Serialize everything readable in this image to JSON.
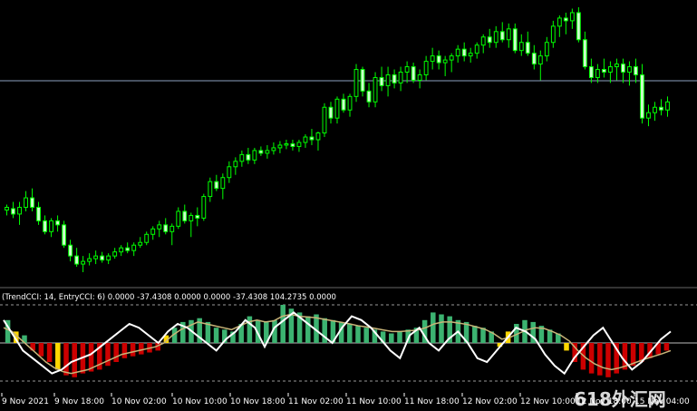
{
  "chart_data": [
    {
      "type": "candlestick",
      "title": "",
      "grid": false,
      "colors": {
        "up": "#00ff00",
        "up_body": "#000000",
        "down": "#00ff00",
        "down_body": "#ccffcc",
        "background": "#000000",
        "level_line": "#8b9fbf"
      },
      "y_range": [
        0,
        100
      ],
      "level": 74,
      "candles": [
        [
          56,
          60,
          52,
          58
        ],
        [
          57,
          62,
          50,
          53
        ],
        [
          53,
          62,
          45,
          58
        ],
        [
          58,
          70,
          55,
          65
        ],
        [
          65,
          72,
          55,
          58
        ],
        [
          58,
          62,
          45,
          48
        ],
        [
          48,
          52,
          38,
          40
        ],
        [
          40,
          50,
          36,
          48
        ],
        [
          48,
          52,
          40,
          45
        ],
        [
          45,
          48,
          28,
          30
        ],
        [
          30,
          34,
          18,
          22
        ],
        [
          22,
          28,
          14,
          16
        ],
        [
          16,
          22,
          10,
          18
        ],
        [
          18,
          24,
          15,
          20
        ],
        [
          20,
          26,
          16,
          22
        ],
        [
          22,
          25,
          17,
          19
        ],
        [
          19,
          24,
          16,
          22
        ],
        [
          22,
          28,
          20,
          25
        ],
        [
          25,
          30,
          22,
          28
        ],
        [
          28,
          32,
          24,
          26
        ],
        [
          26,
          32,
          22,
          30
        ],
        [
          30,
          36,
          28,
          32
        ],
        [
          32,
          40,
          30,
          38
        ],
        [
          38,
          44,
          34,
          42
        ],
        [
          42,
          48,
          36,
          45
        ],
        [
          45,
          50,
          38,
          40
        ],
        [
          40,
          46,
          30,
          44
        ],
        [
          44,
          58,
          42,
          55
        ],
        [
          55,
          60,
          46,
          48
        ],
        [
          48,
          54,
          36,
          52
        ],
        [
          52,
          58,
          44,
          50
        ],
        [
          50,
          68,
          48,
          66
        ],
        [
          66,
          80,
          62,
          77
        ],
        [
          77,
          82,
          70,
          72
        ],
        [
          72,
          83,
          64,
          80
        ],
        [
          80,
          92,
          76,
          88
        ],
        [
          88,
          95,
          82,
          92
        ],
        [
          92,
          100,
          88,
          97
        ],
        [
          97,
          102,
          90,
          93
        ],
        [
          93,
          102,
          90,
          100
        ],
        [
          100,
          103,
          96,
          98
        ],
        [
          98,
          104,
          94,
          100
        ],
        [
          100,
          106,
          97,
          102
        ],
        [
          102,
          107,
          98,
          104
        ],
        [
          104,
          108,
          101,
          105
        ],
        [
          105,
          108,
          100,
          103
        ],
        [
          103,
          108,
          99,
          106
        ],
        [
          106,
          112,
          102,
          110
        ],
        [
          110,
          116,
          104,
          108
        ],
        [
          108,
          114,
          100,
          113
        ],
        [
          113,
          135,
          110,
          132
        ],
        [
          132,
          136,
          120,
          124
        ],
        [
          124,
          140,
          120,
          138
        ],
        [
          138,
          142,
          128,
          130
        ],
        [
          130,
          142,
          125,
          140
        ],
        [
          140,
          164,
          136,
          160
        ],
        [
          160,
          162,
          140,
          144
        ],
        [
          144,
          150,
          132,
          136
        ],
        [
          136,
          158,
          132,
          154
        ],
        [
          154,
          162,
          144,
          148
        ],
        [
          148,
          162,
          140,
          156
        ],
        [
          156,
          160,
          146,
          150
        ],
        [
          150,
          162,
          144,
          158
        ],
        [
          158,
          166,
          150,
          162
        ],
        [
          162,
          165,
          150,
          152
        ],
        [
          152,
          160,
          146,
          156
        ],
        [
          156,
          170,
          152,
          166
        ],
        [
          166,
          176,
          160,
          170
        ],
        [
          170,
          174,
          160,
          165
        ],
        [
          165,
          170,
          155,
          167
        ],
        [
          167,
          172,
          158,
          170
        ],
        [
          170,
          178,
          165,
          175
        ],
        [
          175,
          180,
          166,
          170
        ],
        [
          170,
          176,
          165,
          172
        ],
        [
          172,
          180,
          168,
          178
        ],
        [
          178,
          186,
          172,
          184
        ],
        [
          184,
          190,
          176,
          180
        ],
        [
          180,
          192,
          176,
          188
        ],
        [
          188,
          195,
          180,
          182
        ],
        [
          182,
          194,
          176,
          190
        ],
        [
          190,
          194,
          172,
          174
        ],
        [
          174,
          186,
          170,
          180
        ],
        [
          180,
          188,
          170,
          172
        ],
        [
          172,
          178,
          160,
          164
        ],
        [
          164,
          174,
          152,
          170
        ],
        [
          170,
          184,
          166,
          180
        ],
        [
          180,
          196,
          176,
          192
        ],
        [
          192,
          200,
          184,
          198
        ],
        [
          198,
          202,
          186,
          196
        ],
        [
          196,
          205,
          190,
          202
        ],
        [
          202,
          206,
          180,
          182
        ],
        [
          182,
          188,
          160,
          162
        ],
        [
          162,
          168,
          150,
          154
        ],
        [
          154,
          164,
          150,
          160
        ],
        [
          160,
          168,
          154,
          158
        ],
        [
          158,
          166,
          150,
          162
        ],
        [
          162,
          168,
          152,
          164
        ],
        [
          164,
          168,
          150,
          158
        ],
        [
          158,
          166,
          148,
          162
        ],
        [
          162,
          168,
          150,
          156
        ],
        [
          156,
          164,
          120,
          124
        ],
        [
          124,
          134,
          118,
          128
        ],
        [
          128,
          136,
          122,
          132
        ],
        [
          132,
          138,
          126,
          130
        ],
        [
          130,
          140,
          125,
          136
        ]
      ]
    },
    {
      "type": "histogram",
      "label": "(TrendCCI: 14, EntryCCI: 6) 0.0000 -37.4308 0.0000 0.0000 -37.4308 104.2735 0.0000",
      "colors": {
        "positive": "#3cb371",
        "negative": "#cc0000",
        "highlight": "#ffd700",
        "neutral": "#bbbbbb",
        "cci_line": "#ffffff",
        "trend_line": "#c8b478"
      },
      "y_range": [
        -100,
        100
      ],
      "levels": [
        100,
        0,
        -100
      ],
      "histogram": [
        60,
        30,
        20,
        -20,
        -35,
        -50,
        -70,
        -85,
        -90,
        -80,
        -75,
        -70,
        -60,
        -50,
        -40,
        -35,
        -30,
        -25,
        -20,
        20,
        40,
        55,
        60,
        65,
        55,
        40,
        35,
        30,
        50,
        70,
        60,
        55,
        60,
        100,
        90,
        80,
        70,
        75,
        65,
        60,
        55,
        50,
        45,
        40,
        35,
        30,
        25,
        30,
        35,
        40,
        60,
        80,
        75,
        70,
        60,
        55,
        45,
        40,
        30,
        -10,
        30,
        50,
        60,
        55,
        45,
        35,
        25,
        -20,
        -50,
        -70,
        -80,
        -85,
        -90,
        -80,
        -70,
        -60,
        -50,
        -40,
        -30,
        -20
      ],
      "cci": [
        60,
        20,
        -20,
        -40,
        -60,
        -80,
        -70,
        -50,
        -40,
        -30,
        -10,
        10,
        30,
        50,
        40,
        20,
        0,
        30,
        50,
        40,
        20,
        0,
        -20,
        10,
        30,
        60,
        40,
        -10,
        40,
        60,
        80,
        60,
        40,
        20,
        0,
        40,
        70,
        60,
        40,
        10,
        -20,
        -40,
        20,
        40,
        0,
        -20,
        10,
        30,
        0,
        -40,
        -50,
        -20,
        10,
        40,
        30,
        10,
        -30,
        -60,
        -80,
        -40,
        -10,
        20,
        40,
        0,
        -40,
        -70,
        -50,
        -20,
        10,
        30
      ],
      "trend": [
        40,
        30,
        10,
        -10,
        -30,
        -50,
        -65,
        -75,
        -80,
        -75,
        -70,
        -60,
        -50,
        -40,
        -30,
        -25,
        -20,
        -15,
        -10,
        0,
        20,
        35,
        45,
        55,
        50,
        45,
        40,
        35,
        45,
        55,
        60,
        55,
        58,
        70,
        75,
        70,
        68,
        66,
        62,
        58,
        54,
        50,
        45,
        42,
        38,
        34,
        30,
        30,
        32,
        34,
        40,
        50,
        55,
        55,
        52,
        48,
        42,
        36,
        25,
        10,
        15,
        25,
        35,
        40,
        38,
        30,
        20,
        5,
        -20,
        -40,
        -55,
        -65,
        -70,
        -65,
        -58,
        -50,
        -42,
        -35,
        -28,
        -20
      ]
    }
  ],
  "x_axis": {
    "ticks": [
      "9 Nov 2021",
      "9 Nov 18:00",
      "10 Nov 02:00",
      "10 Nov 10:00",
      "10 Nov 18:00",
      "11 Nov 02:00",
      "11 Nov 10:00",
      "11 Nov 18:00",
      "12 Nov 02:00",
      "12 Nov 10:00",
      "12 Nov 18:00",
      "15 Nov 04:00"
    ]
  },
  "watermark": "618外汇网"
}
